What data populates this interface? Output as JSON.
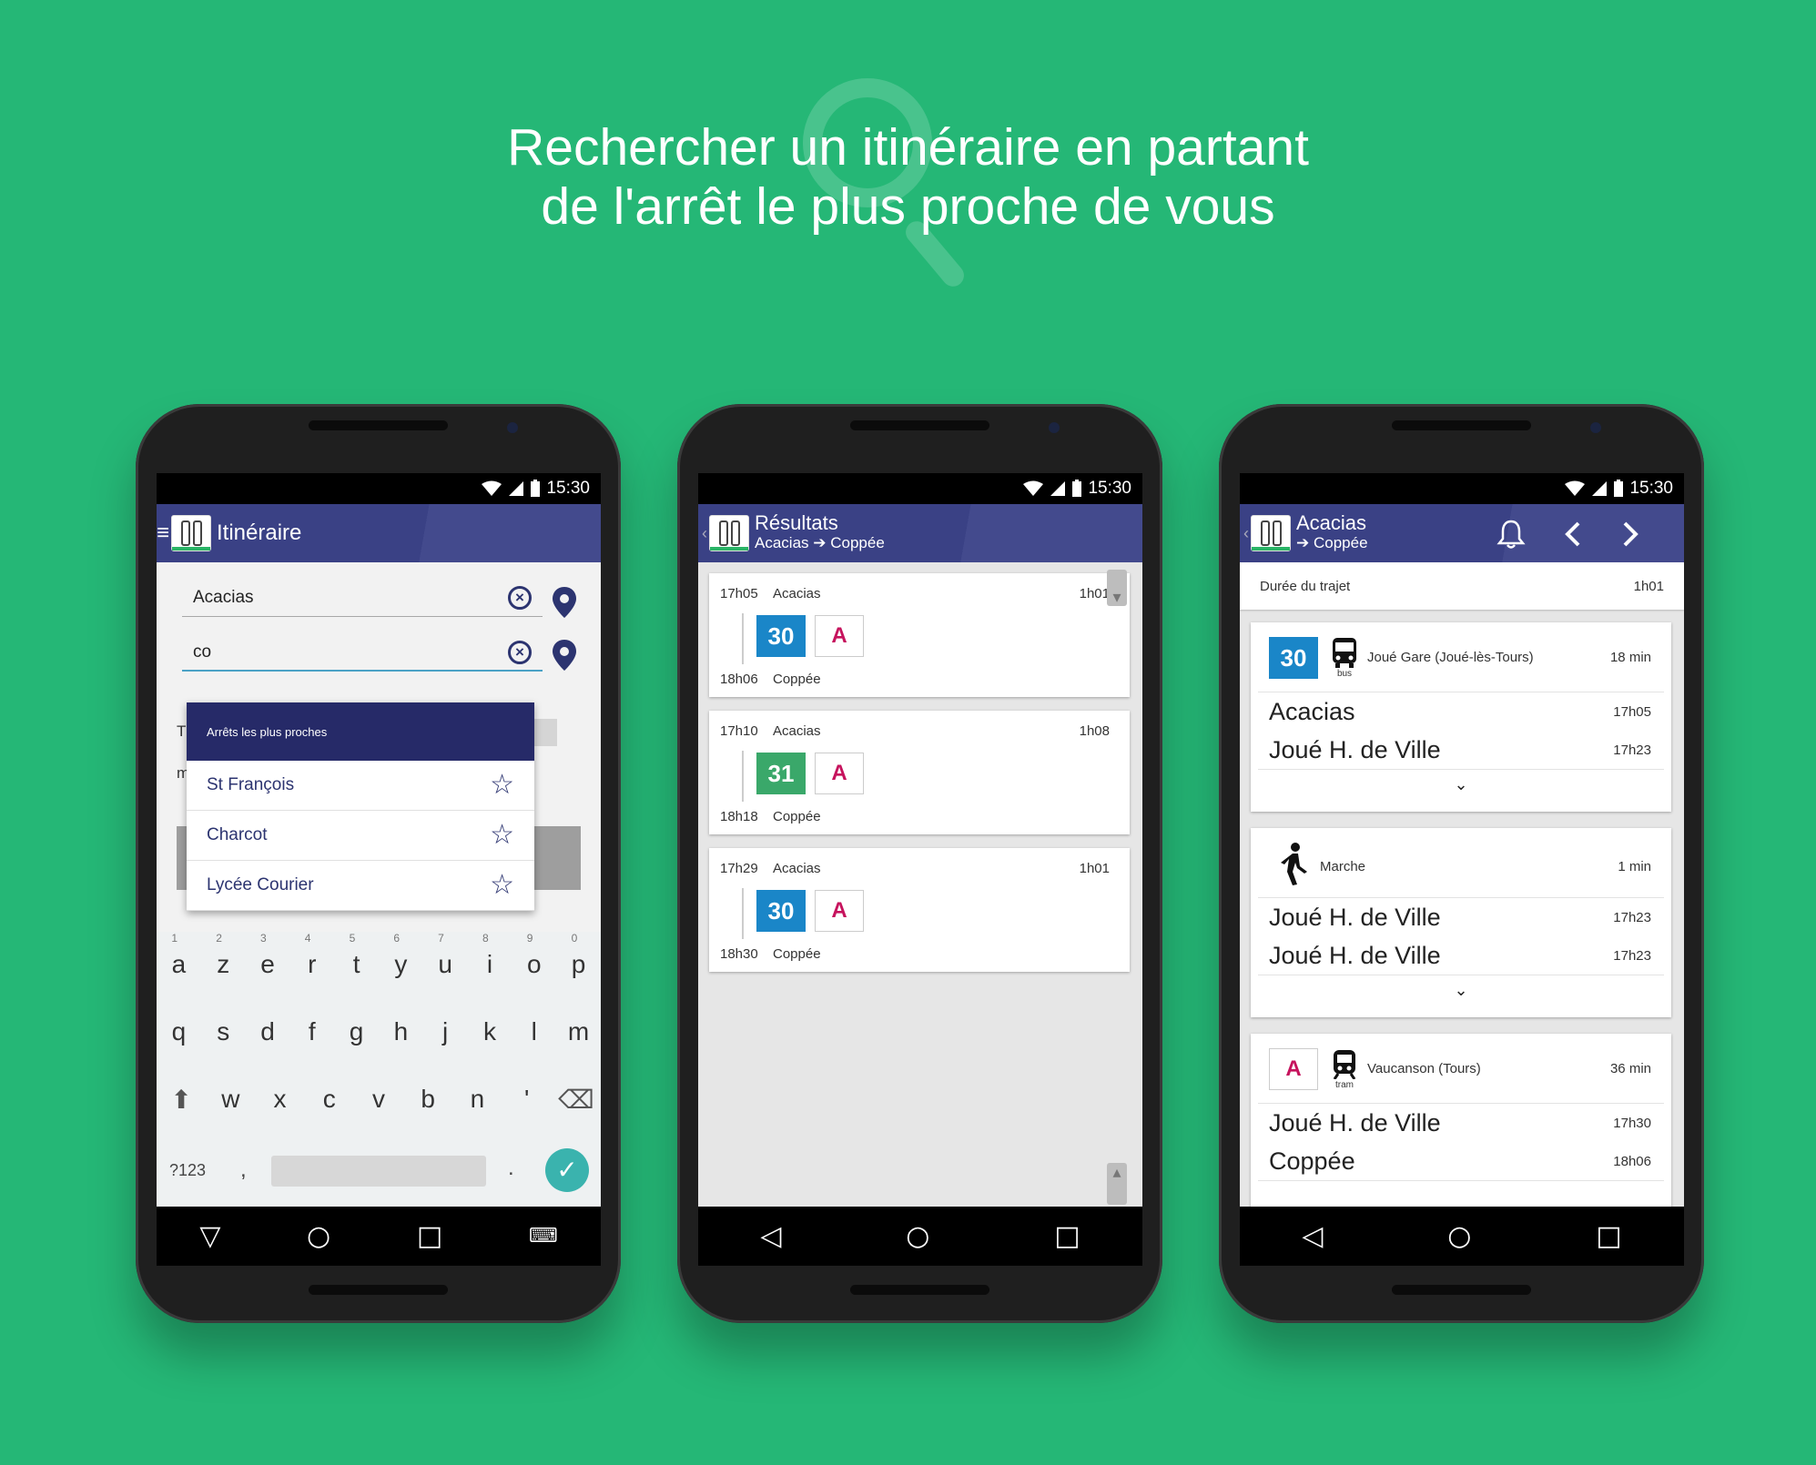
{
  "headline": {
    "line1": "Rechercher un itinéraire en partant",
    "line2": "de l'arrêt le plus proche de vous"
  },
  "status": {
    "time": "15:30"
  },
  "phone1": {
    "title": "Itinéraire",
    "from_value": "Acacias",
    "to_value": "co",
    "dropdown_header": "Arrêts les plus proches",
    "stops": [
      "St François",
      "Charcot",
      "Lycée Courier"
    ],
    "kb_row1": [
      "a",
      "z",
      "e",
      "r",
      "t",
      "y",
      "u",
      "i",
      "o",
      "p"
    ],
    "kb_row1_nums": [
      "1",
      "2",
      "3",
      "4",
      "5",
      "6",
      "7",
      "8",
      "9",
      "0"
    ],
    "kb_row2": [
      "q",
      "s",
      "d",
      "f",
      "g",
      "h",
      "j",
      "k",
      "l",
      "m"
    ],
    "kb_row3": [
      "w",
      "x",
      "c",
      "v",
      "b",
      "n",
      "'"
    ],
    "kb_num": "?123",
    "kb_comma": ",",
    "kb_dot": ".",
    "bg_letters": [
      "T",
      "m"
    ]
  },
  "phone2": {
    "title": "Résultats",
    "subtitle_from": "Acacias",
    "subtitle_to": "Coppée",
    "results": [
      {
        "dep_time": "17h05",
        "dep_stop": "Acacias",
        "duration": "1h01",
        "line": "30",
        "line_color": "#1a86c8",
        "arr_time": "18h06",
        "arr_stop": "Coppée"
      },
      {
        "dep_time": "17h10",
        "dep_stop": "Acacias",
        "duration": "1h08",
        "line": "31",
        "line_color": "#3aa86a",
        "arr_time": "18h18",
        "arr_stop": "Coppée"
      },
      {
        "dep_time": "17h29",
        "dep_stop": "Acacias",
        "duration": "1h01",
        "line": "30",
        "line_color": "#1a86c8",
        "arr_time": "18h30",
        "arr_stop": "Coppée"
      }
    ],
    "tram_line": "A"
  },
  "phone3": {
    "title": "Acacias",
    "subtitle": "Coppée",
    "duration_label": "Durée du trajet",
    "duration_value": "1h01",
    "seg1": {
      "line": "30",
      "mode": "bus",
      "direction": "Joué Gare (Joué-lès-Tours)",
      "time": "18 min",
      "stop1": "Acacias",
      "t1": "17h05",
      "stop2": "Joué H. de Ville",
      "t2": "17h23"
    },
    "seg2": {
      "label": "Marche",
      "time": "1 min",
      "stop1": "Joué H. de Ville",
      "t1": "17h23",
      "stop2": "Joué H. de Ville",
      "t2": "17h23"
    },
    "seg3": {
      "line": "A",
      "mode": "tram",
      "direction": "Vaucanson (Tours)",
      "time": "36 min",
      "stop1": "Joué H. de Ville",
      "t1": "17h30",
      "stop2": "Coppée",
      "t2": "18h06"
    }
  },
  "colors": {
    "background": "#25b776",
    "appbar": "#3d4486",
    "line30": "#1a86c8",
    "line31": "#3aa86a",
    "tramA": "#c6135d"
  }
}
